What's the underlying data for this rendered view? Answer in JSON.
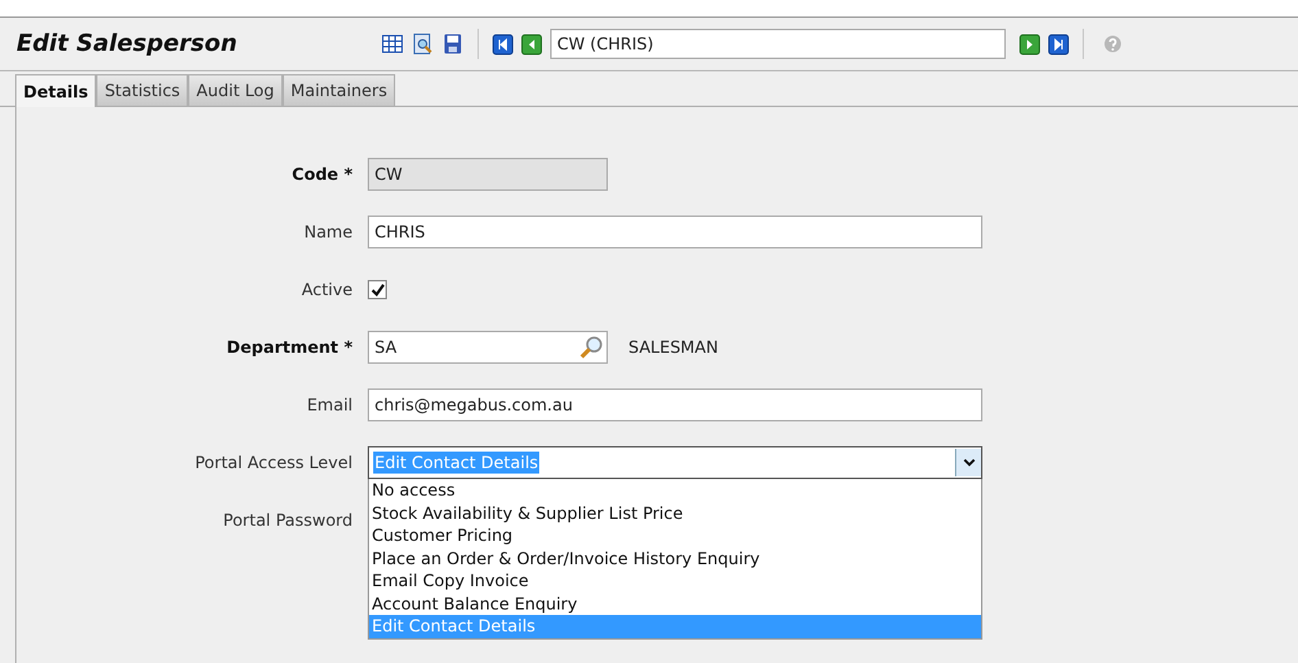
{
  "window": {
    "title": "Edit Salesperson"
  },
  "record_field": {
    "value": "CW (CHRIS)"
  },
  "tabs": [
    {
      "label": "Details",
      "selected": true
    },
    {
      "label": "Statistics",
      "selected": false
    },
    {
      "label": "Audit Log",
      "selected": false
    },
    {
      "label": "Maintainers",
      "selected": false
    }
  ],
  "fields": [
    {
      "kind": "text",
      "label": "Code *",
      "required": true,
      "value": "CW",
      "disabled": true,
      "wide": false
    },
    {
      "kind": "text",
      "label": "Name",
      "required": false,
      "value": "CHRIS",
      "disabled": false,
      "wide": true
    },
    {
      "kind": "checkbox",
      "label": "Active",
      "required": false,
      "checked": true
    },
    {
      "kind": "lookup",
      "label": "Department *",
      "required": true,
      "value": "SA",
      "description": "SALESMAN"
    },
    {
      "kind": "text",
      "label": "Email",
      "required": false,
      "value": "chris@megabus.com.au",
      "disabled": false,
      "wide": true
    },
    {
      "kind": "select",
      "label": "Portal Access Level",
      "required": false,
      "value": "Edit Contact Details",
      "expanded": true,
      "options": [
        {
          "label": "No access",
          "selected": false
        },
        {
          "label": "Stock Availability & Supplier List Price",
          "selected": false
        },
        {
          "label": "Customer Pricing",
          "selected": false
        },
        {
          "label": "Place an Order & Order/Invoice History Enquiry",
          "selected": false
        },
        {
          "label": "Email Copy Invoice",
          "selected": false
        },
        {
          "label": "Account Balance Enquiry",
          "selected": false
        },
        {
          "label": "Edit Contact Details",
          "selected": true
        }
      ]
    },
    {
      "kind": "password",
      "label": "Portal Password",
      "required": false
    }
  ]
}
